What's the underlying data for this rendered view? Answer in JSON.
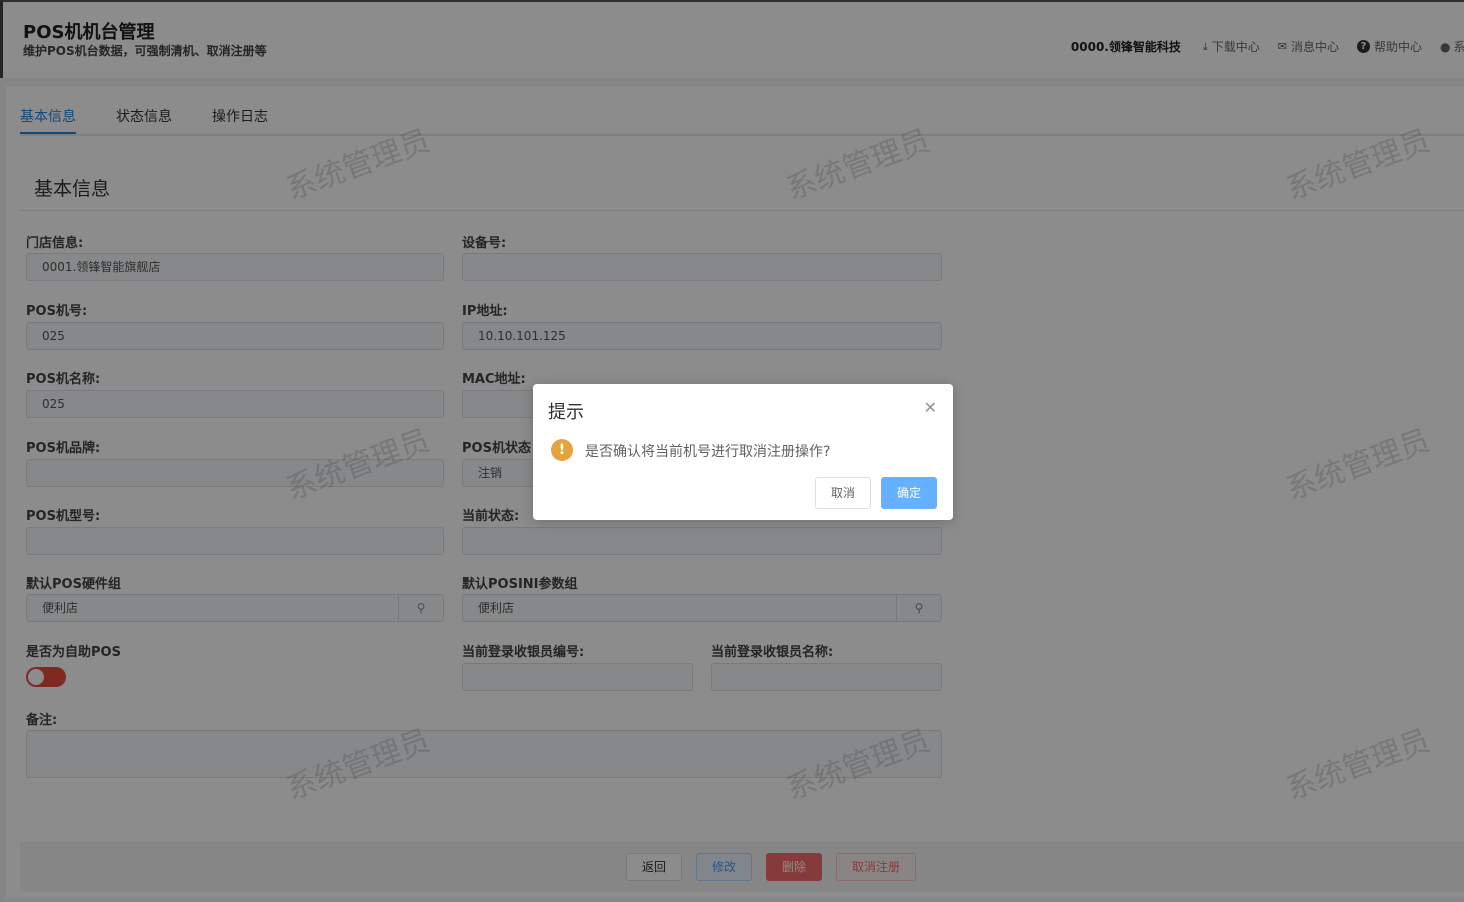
{
  "header": {
    "title": "POS机机台管理",
    "subtitle": "维护POS机台数据，可强制清机、取消注册等",
    "company": "0000.领锋智能科技",
    "download_label": "下载中心",
    "message_label": "消息中心",
    "help_label": "帮助中心",
    "user_label": "系"
  },
  "tabs": [
    {
      "label": "基本信息",
      "active": true
    },
    {
      "label": "状态信息",
      "active": false
    },
    {
      "label": "操作日志",
      "active": false
    }
  ],
  "section_title": "基本信息",
  "form": {
    "store_label": "门店信息:",
    "store_value": "0001.领锋智能旗舰店",
    "device_label": "设备号:",
    "device_value": "",
    "pos_no_label": "POS机号:",
    "pos_no_value": "025",
    "ip_label": "IP地址:",
    "ip_value": "10.10.101.125",
    "pos_name_label": "POS机名称:",
    "pos_name_value": "025",
    "mac_label": "MAC地址:",
    "mac_value": "",
    "brand_label": "POS机品牌:",
    "brand_value": "",
    "status_label": "POS机状态",
    "status_value": "注销",
    "model_label": "POS机型号:",
    "model_value": "",
    "current_status_label": "当前状态:",
    "current_status_value": "",
    "hw_group_label": "默认POS硬件组",
    "hw_group_value": "便利店",
    "ini_group_label": "默认POSINI参数组",
    "ini_group_value": "便利店",
    "self_pos_label": "是否为自助POS",
    "self_pos_on": false,
    "cashier_no_label": "当前登录收银员编号:",
    "cashier_no_value": "",
    "cashier_name_label": "当前登录收银员名称:",
    "cashier_name_value": "",
    "remark_label": "备注:",
    "remark_value": ""
  },
  "footer": {
    "back_label": "返回",
    "edit_label": "修改",
    "delete_label": "删除",
    "unregister_label": "取消注册"
  },
  "watermark_text": "系统管理员",
  "dialog": {
    "title": "提示",
    "message": "是否确认将当前机号进行取消注册操作?",
    "cancel_label": "取消",
    "ok_label": "确定",
    "icon": "warning-icon"
  },
  "colors": {
    "accent": "#1f86e0",
    "danger": "#f56c6c",
    "warning": "#e6a23c",
    "primary_light": "#66b1ff"
  }
}
